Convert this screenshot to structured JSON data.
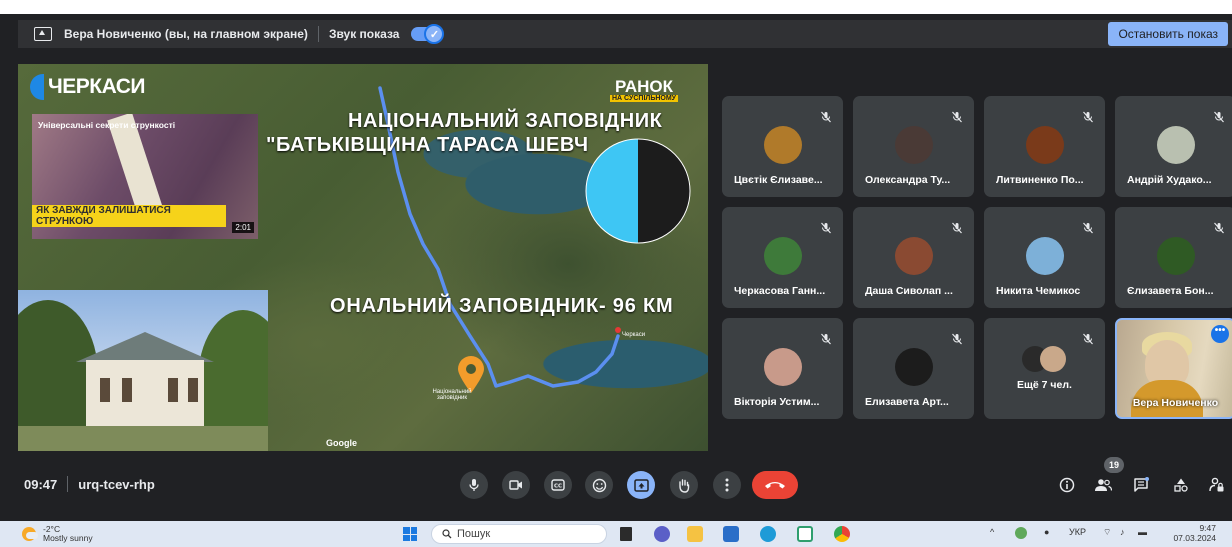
{
  "presentation_bar": {
    "presenter": "Вера Новиченко (вы, на главном экране)",
    "sound_label": "Звук показа",
    "sound_enabled": true,
    "stop_button": "Остановить показ"
  },
  "shared_screen": {
    "channel_logo": "ЧЕРКАСИ",
    "show_logo": "РАНОК",
    "show_logo_sub": "НА СУСПІЛЬНОМУ",
    "headline_line1": "НАЦІОНАЛЬНИЙ ЗАПОВІДНИК",
    "headline_line2": "\"БАТЬКІВЩИНА ТАРАСА ШЕВЧ",
    "distance_caption": "ОНАЛЬНИЙ ЗАПОВІДНИК- 96 КМ",
    "video_thumb": {
      "title": "Універсальні секрети стрункості",
      "banner": "ЯК ЗАВЖДИ ЗАЛИШАТИСЯ СТРУНКОЮ",
      "duration": "2:01"
    },
    "map": {
      "destination_label": "Національний заповідник",
      "city_label": "Черкаси",
      "attribution": "Google"
    },
    "pie_colors": {
      "left": "#3ec6f4",
      "right": "#1c1c1c"
    }
  },
  "participants": [
    {
      "name": "Цвєтік Єлизаве...",
      "muted": true,
      "avatar_color": "#b07a2a"
    },
    {
      "name": "Олександра Ту...",
      "muted": true,
      "avatar_color": "#4a3a36"
    },
    {
      "name": "Литвиненко По...",
      "muted": true,
      "avatar_color": "#7a3a1a"
    },
    {
      "name": "Андрій Худако...",
      "muted": true,
      "avatar_color": "#b9c0b0"
    },
    {
      "name": "Черкасова Ганн...",
      "muted": true,
      "avatar_color": "#3e7a3a"
    },
    {
      "name": "Даша Сиволап ...",
      "muted": true,
      "avatar_color": "#8a4a32"
    },
    {
      "name": "Никита Чемикос",
      "muted": true,
      "avatar_color": "#7db0d8"
    },
    {
      "name": "Єлизавета Бон...",
      "muted": true,
      "avatar_color": "#2f5a24"
    },
    {
      "name": "Вікторія Устим...",
      "muted": true,
      "avatar_color": "#c89a8a"
    },
    {
      "name": "Елизавета Арт...",
      "muted": true,
      "avatar_color": "#1c1c1c"
    }
  ],
  "more_tile": {
    "label": "Ещё 7 чел.",
    "muted": true
  },
  "self_tile": {
    "name": "Вера Новиченко"
  },
  "meeting": {
    "time": "09:47",
    "code": "urq-tcev-rhp",
    "participant_count": "19"
  },
  "controls": {
    "mic": "mic-icon",
    "camera": "camera-icon",
    "captions": "captions-icon",
    "reactions": "emoji-icon",
    "present": "present-screen-icon",
    "raise_hand": "hand-icon",
    "more": "more-vert-icon",
    "leave": "phone-hangup-icon"
  },
  "taskbar": {
    "temperature": "-2°C",
    "weather": "Mostly sunny",
    "search_placeholder": "Пошук",
    "language": "УКР",
    "time": "9:47",
    "date": "07.03.2024"
  },
  "colors": {
    "background": "#202124",
    "tile": "#3c4043",
    "accent": "#8ab4f8",
    "hangup": "#ea4335"
  }
}
